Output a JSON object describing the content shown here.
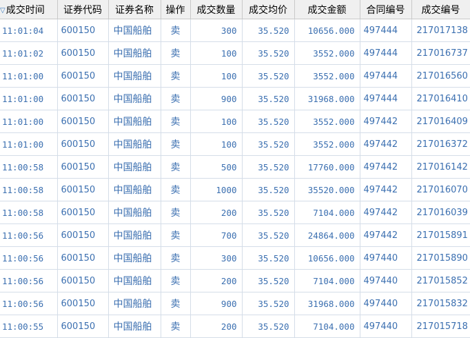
{
  "columns": [
    {
      "label": "成交时间",
      "sorted": true
    },
    {
      "label": "证券代码"
    },
    {
      "label": "证券名称"
    },
    {
      "label": "操作"
    },
    {
      "label": "成交数量"
    },
    {
      "label": "成交均价"
    },
    {
      "label": "成交金额"
    },
    {
      "label": "合同编号"
    },
    {
      "label": "成交编号"
    }
  ],
  "sort_indicator": "▽",
  "rows": [
    [
      "11:01:04",
      "600150",
      "中国船舶",
      "卖",
      "300",
      "35.520",
      "10656.000",
      "497444",
      "217017138"
    ],
    [
      "11:01:02",
      "600150",
      "中国船舶",
      "卖",
      "100",
      "35.520",
      "3552.000",
      "497444",
      "217016737"
    ],
    [
      "11:01:00",
      "600150",
      "中国船舶",
      "卖",
      "100",
      "35.520",
      "3552.000",
      "497444",
      "217016560"
    ],
    [
      "11:01:00",
      "600150",
      "中国船舶",
      "卖",
      "900",
      "35.520",
      "31968.000",
      "497444",
      "217016410"
    ],
    [
      "11:01:00",
      "600150",
      "中国船舶",
      "卖",
      "100",
      "35.520",
      "3552.000",
      "497442",
      "217016409"
    ],
    [
      "11:01:00",
      "600150",
      "中国船舶",
      "卖",
      "100",
      "35.520",
      "3552.000",
      "497442",
      "217016372"
    ],
    [
      "11:00:58",
      "600150",
      "中国船舶",
      "卖",
      "500",
      "35.520",
      "17760.000",
      "497442",
      "217016142"
    ],
    [
      "11:00:58",
      "600150",
      "中国船舶",
      "卖",
      "1000",
      "35.520",
      "35520.000",
      "497442",
      "217016070"
    ],
    [
      "11:00:58",
      "600150",
      "中国船舶",
      "卖",
      "200",
      "35.520",
      "7104.000",
      "497442",
      "217016039"
    ],
    [
      "11:00:56",
      "600150",
      "中国船舶",
      "卖",
      "700",
      "35.520",
      "24864.000",
      "497442",
      "217015891"
    ],
    [
      "11:00:56",
      "600150",
      "中国船舶",
      "卖",
      "300",
      "35.520",
      "10656.000",
      "497440",
      "217015890"
    ],
    [
      "11:00:56",
      "600150",
      "中国船舶",
      "卖",
      "200",
      "35.520",
      "7104.000",
      "497440",
      "217015852"
    ],
    [
      "11:00:56",
      "600150",
      "中国船舶",
      "卖",
      "900",
      "35.520",
      "31968.000",
      "497440",
      "217015832"
    ],
    [
      "11:00:55",
      "600150",
      "中国船舶",
      "卖",
      "200",
      "35.520",
      "7104.000",
      "497440",
      "217015718"
    ]
  ],
  "colors": {
    "cell_text": "#3b6fb0",
    "header_bg": "#f0f0f0",
    "sort_icon": "#3b7bbf"
  }
}
